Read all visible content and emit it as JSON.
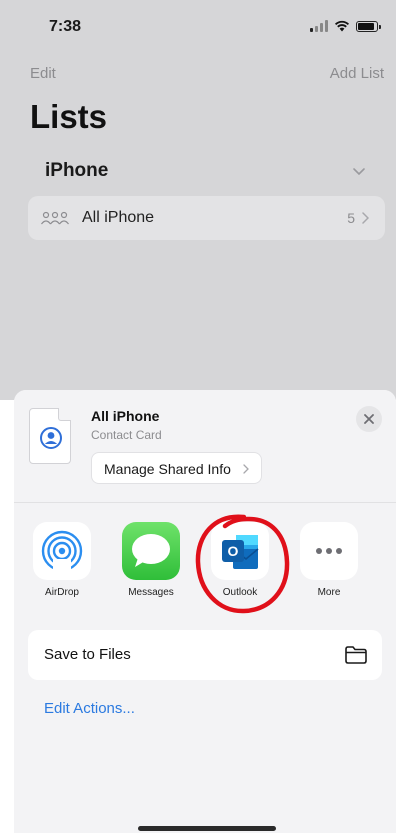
{
  "status_bar": {
    "time": "7:38"
  },
  "app": {
    "edit_label": "Edit",
    "add_list_label": "Add List",
    "title": "Lists",
    "group_title": "iPhone",
    "list_row": {
      "label": "All iPhone",
      "count": "5"
    }
  },
  "share_sheet": {
    "item_title": "All iPhone",
    "item_subtitle": "Contact Card",
    "manage_button_label": "Manage Shared Info",
    "apps": [
      {
        "label": "AirDrop",
        "icon": "airdrop-icon"
      },
      {
        "label": "Messages",
        "icon": "messages-icon"
      },
      {
        "label": "Outlook",
        "icon": "outlook-icon"
      },
      {
        "label": "More",
        "icon": "more-icon"
      }
    ],
    "save_to_files_label": "Save to Files",
    "edit_actions_label": "Edit Actions..."
  },
  "colors": {
    "dimmed_background": "#d6d6d8",
    "sheet_background": "#f3f3f5",
    "link_blue": "#2b7ae0",
    "highlight_red": "#e0101a",
    "outlook_blue": "#0f6cbd"
  }
}
